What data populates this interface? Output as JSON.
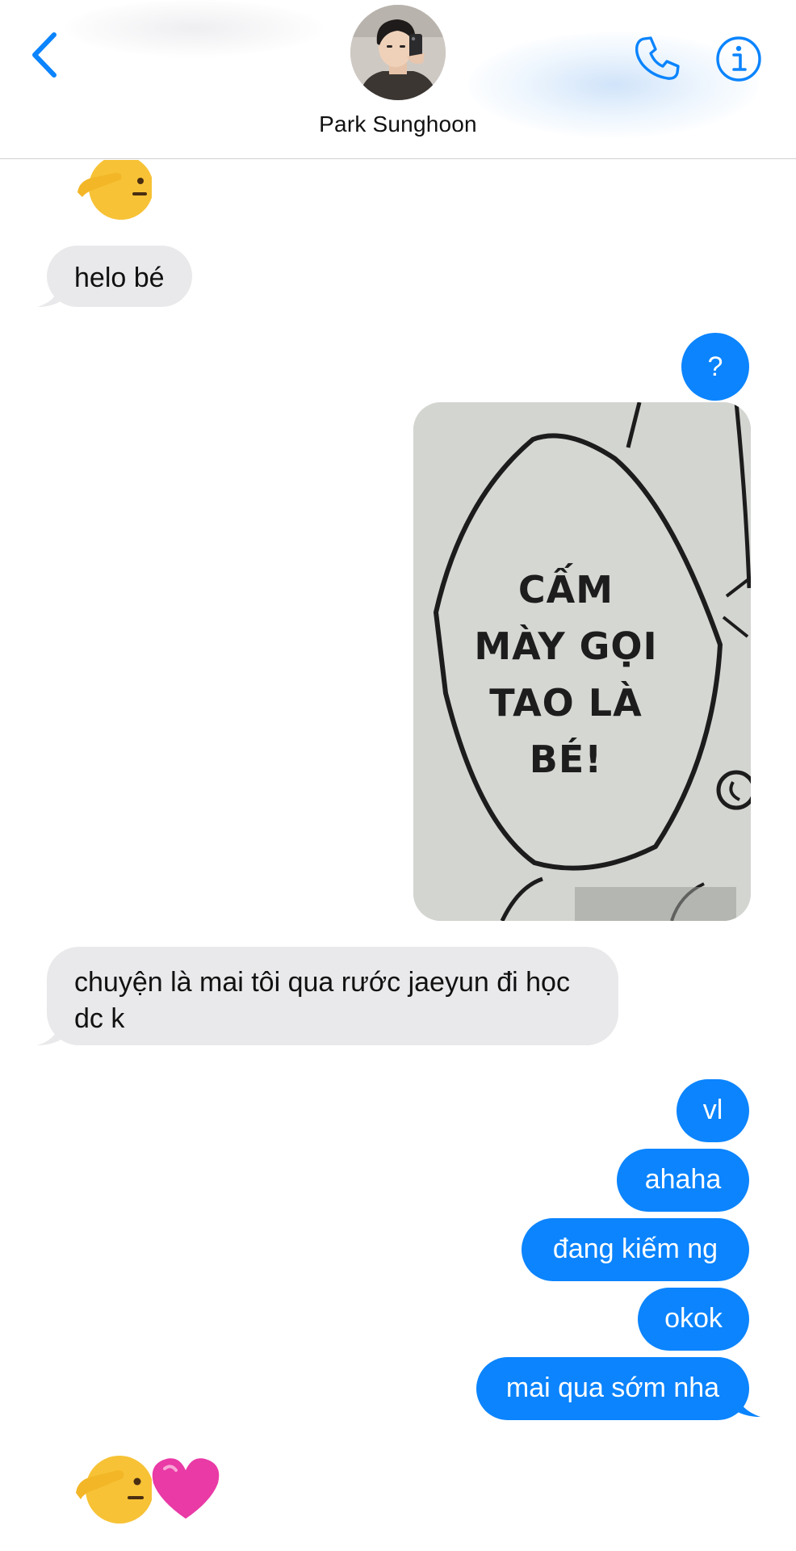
{
  "header": {
    "contact_name": "Park Sunghoon"
  },
  "messages": {
    "m1_text": "helo bé",
    "m2_text": "?",
    "photo_lines": [
      "CẤM",
      "MÀY GỌI",
      "TAO LÀ",
      "BÉ!"
    ],
    "m3_text": "chuyện là mai tôi qua rước jaeyun đi học dc k",
    "m4_text": "vl",
    "m5_text": "ahaha",
    "m6_text": "đang kiếm ng",
    "m7_text": "okok",
    "m8_text": "mai qua sớm nha"
  },
  "colors": {
    "accent": "#0b84fe",
    "incoming_bubble": "#e9e9eb",
    "outgoing_bubble": "#0b84fe"
  },
  "icons": [
    "chevron-left-icon",
    "phone-icon",
    "info-icon",
    "saluting-face-emoji",
    "pink-heart-emoji"
  ]
}
